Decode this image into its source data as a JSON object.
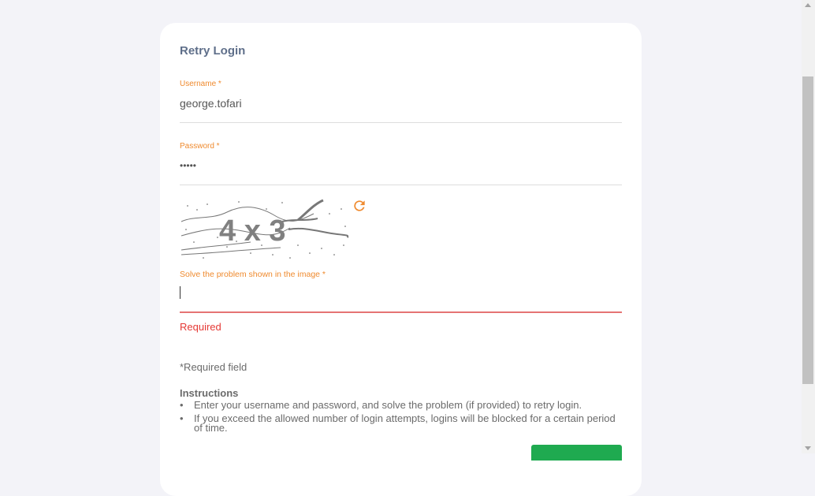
{
  "form": {
    "title": "Retry Login",
    "username_label": "Username *",
    "username_value": "george.tofari",
    "password_label": "Password *",
    "password_value": "•••••",
    "captcha_label": "Solve the problem shown in the image *",
    "captcha_text": "4 x 3",
    "captcha_error": "Required",
    "required_note": "*Required field",
    "instructions_title": "Instructions",
    "instructions": [
      "Enter your username and password, and solve the problem (if provided) to retry login.",
      "If you exceed the allowed number of login attempts, logins will be blocked for a certain period of time."
    ],
    "bullet": "•"
  },
  "icons": {
    "refresh": "refresh-icon"
  },
  "colors": {
    "accent": "#ef8a2e",
    "error": "#e53935",
    "submit": "#1faa50",
    "title": "#5f6f8a"
  }
}
